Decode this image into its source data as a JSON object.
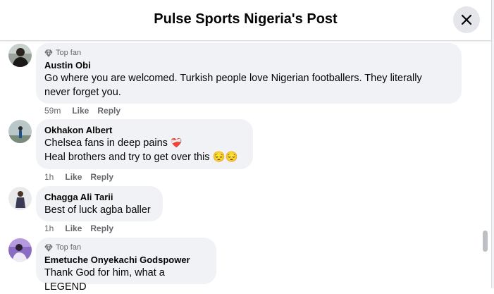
{
  "header": {
    "title": "Pulse Sports Nigeria's Post"
  },
  "comments": [
    {
      "badge": "Top fan",
      "author": "Austin Obi",
      "lines": [
        "Go where you are welcomed. Turkish people love Nigerian footballers. They literally",
        "never forget you."
      ],
      "time": "59m",
      "like": "Like",
      "reply": "Reply"
    },
    {
      "author": "Okhakon Albert",
      "lines": [
        "Chelsea fans in deep pains",
        "Heal brothers and try to get over this"
      ],
      "emoji1": "❤️‍🩹",
      "emoji2": "😔😔",
      "time": "1h",
      "like": "Like",
      "reply": "Reply"
    },
    {
      "author": "Chagga Ali Tarii",
      "lines": [
        "Best of luck agba baller"
      ],
      "time": "1h",
      "like": "Like",
      "reply": "Reply"
    },
    {
      "badge": "Top fan",
      "author": "Emetuche Onyekachi Godspower",
      "lines": [
        "Thank God for him, what a LEGEND"
      ]
    }
  ],
  "colors": {
    "bubble": "#f0f2f5",
    "meta": "#65676b",
    "text": "#050505"
  },
  "icons": {
    "close": "close-icon",
    "badge": "diamond-badge-icon"
  }
}
